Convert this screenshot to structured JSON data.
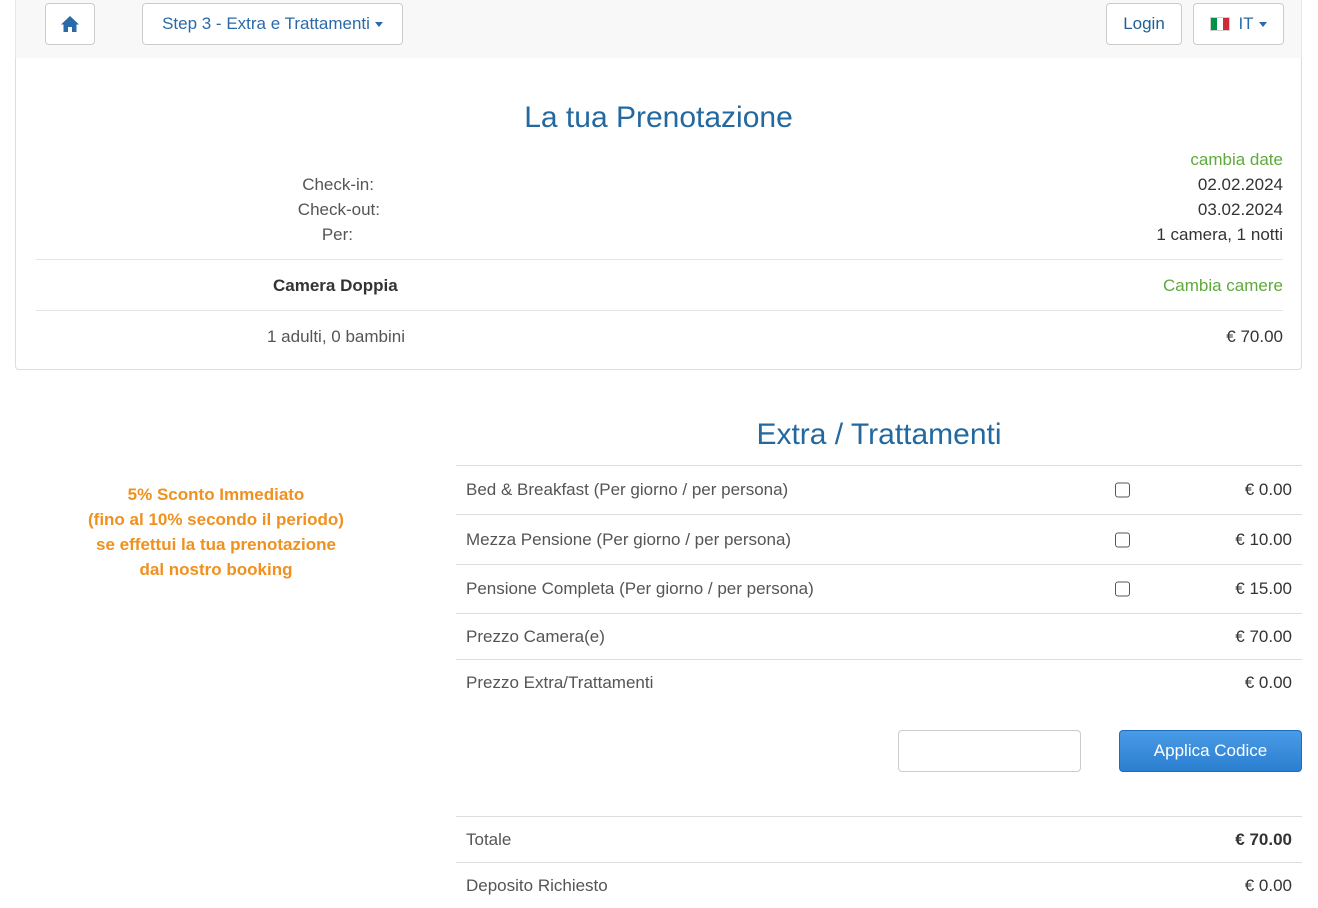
{
  "navbar": {
    "home_icon": "home-icon",
    "step_label": "Step 3 - Extra e Trattamenti",
    "login_label": "Login",
    "lang_label": "IT",
    "flag_colors": [
      "#009246",
      "#ffffff",
      "#ce2b37"
    ]
  },
  "booking": {
    "title": "La tua Prenotazione",
    "change_dates_link": "cambia date",
    "checkin_label": "Check-in:",
    "checkin_value": "02.02.2024",
    "checkout_label": "Check-out:",
    "checkout_value": "03.02.2024",
    "per_label": "Per:",
    "per_value": "1 camera, 1 notti",
    "room_name": "Camera Doppia",
    "change_rooms_link": "Cambia camere",
    "guests": "1 adulti, 0 bambini",
    "room_price": "€ 70.00"
  },
  "promo": {
    "line1": "5% Sconto Immediato",
    "line2": "(fino al 10% secondo il periodo)",
    "line3": "se effettui la tua prenotazione",
    "line4": "dal nostro booking"
  },
  "extras": {
    "title": "Extra / Trattamenti",
    "options": [
      {
        "label": "Bed & Breakfast (Per giorno / per persona)",
        "price": "€ 0.00",
        "checked": false
      },
      {
        "label": "Mezza Pensione (Per giorno / per persona)",
        "price": "€ 10.00",
        "checked": false
      },
      {
        "label": "Pensione Completa (Per giorno / per persona)",
        "price": "€ 15.00",
        "checked": false
      }
    ],
    "room_price_label": "Prezzo Camera(e)",
    "room_price_value": "€ 70.00",
    "extras_price_label": "Prezzo Extra/Trattamenti",
    "extras_price_value": "€ 0.00",
    "coupon_placeholder": "",
    "apply_button": "Applica Codice",
    "total_label": "Totale",
    "total_value": "€ 70.00",
    "deposit_label": "Deposito Richiesto",
    "deposit_value": "€ 0.00"
  },
  "colors": {
    "accent_blue": "#23689e",
    "link_green": "#5faa3c",
    "promo_orange": "#f0901e",
    "button_blue": "#2b7fd0"
  }
}
